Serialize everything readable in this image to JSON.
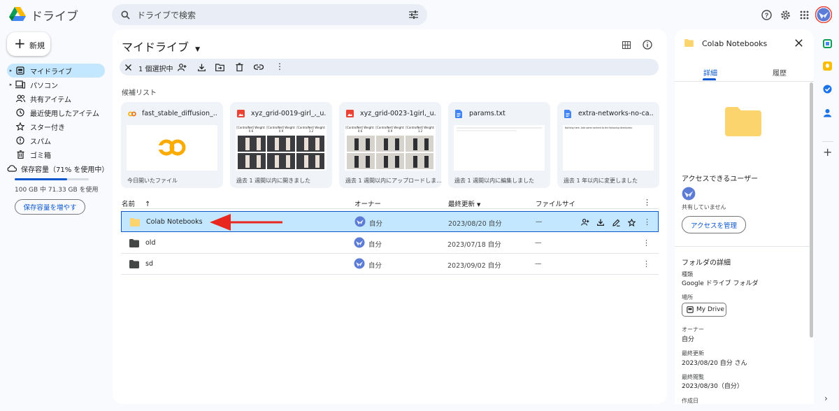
{
  "app": {
    "title": "ドライブ"
  },
  "search": {
    "placeholder": "ドライブで検索"
  },
  "new_button": {
    "label": "新規"
  },
  "sidebar": {
    "items": [
      {
        "label": "マイドライブ",
        "icon": "my-drive-icon",
        "active": true,
        "caret": true
      },
      {
        "label": "パソコン",
        "icon": "computer-icon",
        "active": false,
        "caret": true
      },
      {
        "label": "共有アイテム",
        "icon": "shared-icon",
        "active": false,
        "caret": false
      },
      {
        "label": "最近使用したアイテム",
        "icon": "clock-icon",
        "active": false,
        "caret": false
      },
      {
        "label": "スター付き",
        "icon": "star-icon",
        "active": false,
        "caret": false
      },
      {
        "label": "スパム",
        "icon": "spam-icon",
        "active": false,
        "caret": false
      },
      {
        "label": "ゴミ箱",
        "icon": "trash-icon",
        "active": false,
        "caret": false
      },
      {
        "label": "保存容量（71% を使用中）",
        "icon": "cloud-icon",
        "active": false,
        "caret": false
      }
    ],
    "storage_usage_percent": 71,
    "storage_text": "100 GB 中 71.33 GB を使用",
    "buy_storage_label": "保存容量を増やす"
  },
  "main": {
    "title": "マイドライブ",
    "selection_text": "1 個選択中",
    "suggested_label": "候補リスト",
    "cards": [
      {
        "name": "fast_stable_diffusion_...",
        "icon": "colab-icon",
        "footer": "今日開いたファイル",
        "thumb": "colab"
      },
      {
        "name": "xyz_grid-0019-girl_,_u...",
        "icon": "image-icon",
        "footer": "過去 1 週間以内に開きました",
        "thumb": "grid"
      },
      {
        "name": "xyz_grid-0023-1girl,_u...",
        "icon": "image-icon",
        "footer": "過去 1 週間以内にアップロードしま...",
        "thumb": "grid2"
      },
      {
        "name": "params.txt",
        "icon": "doc-icon",
        "footer": "過去 1 週間以内に編集しました",
        "thumb": "text"
      },
      {
        "name": "extra-networks-no-ca...",
        "icon": "doc-icon",
        "footer": "過去 1 年以内に変更しました",
        "thumb": "text2"
      }
    ],
    "grid_caption": {
      "col1": "[ControlNet] Weight: 0.6",
      "col2": "[ControlNet] Weight: 0.9",
      "col3": "[ControlNet] Weight: 1.2"
    },
    "text_thumb_line": "Nothing here. Add some content to the following directories:",
    "table": {
      "headers": {
        "name": "名前",
        "owner": "オーナー",
        "modified": "最終更新",
        "size": "ファイルサイ"
      },
      "rows": [
        {
          "name": "Colab Notebooks",
          "owner": "自分",
          "modified": "2023/08/20 自分",
          "size": "—",
          "selected": true,
          "color": "#fbd46d"
        },
        {
          "name": "old",
          "owner": "自分",
          "modified": "2023/07/18 自分",
          "size": "—",
          "selected": false,
          "color": "#444746"
        },
        {
          "name": "sd",
          "owner": "自分",
          "modified": "2023/09/02 自分",
          "size": "—",
          "selected": false,
          "color": "#444746"
        }
      ]
    }
  },
  "details_panel": {
    "title": "Colab Notebooks",
    "tabs": [
      "詳細",
      "履歴"
    ],
    "access_heading": "アクセスできるユーザー",
    "not_shared": "共有していません",
    "manage_access": "アクセスを管理",
    "folder_details_heading": "フォルダの詳細",
    "type_label": "種類",
    "type_value": "Google ドライブ フォルダ",
    "location_label": "場所",
    "location_value": "My Drive",
    "owner_label": "オーナー",
    "owner_value": "自分",
    "modified_label": "最終更新",
    "modified_value": "2023/08/20 自分 さん",
    "opened_label": "最終閲覧",
    "opened_value": "2023/08/30（自分）",
    "created_label": "作成日"
  },
  "colors": {
    "accent": "#0b57d0",
    "selected": "#c2e7ff",
    "folder": "#fbd46d",
    "arrow": "#e8281e"
  }
}
